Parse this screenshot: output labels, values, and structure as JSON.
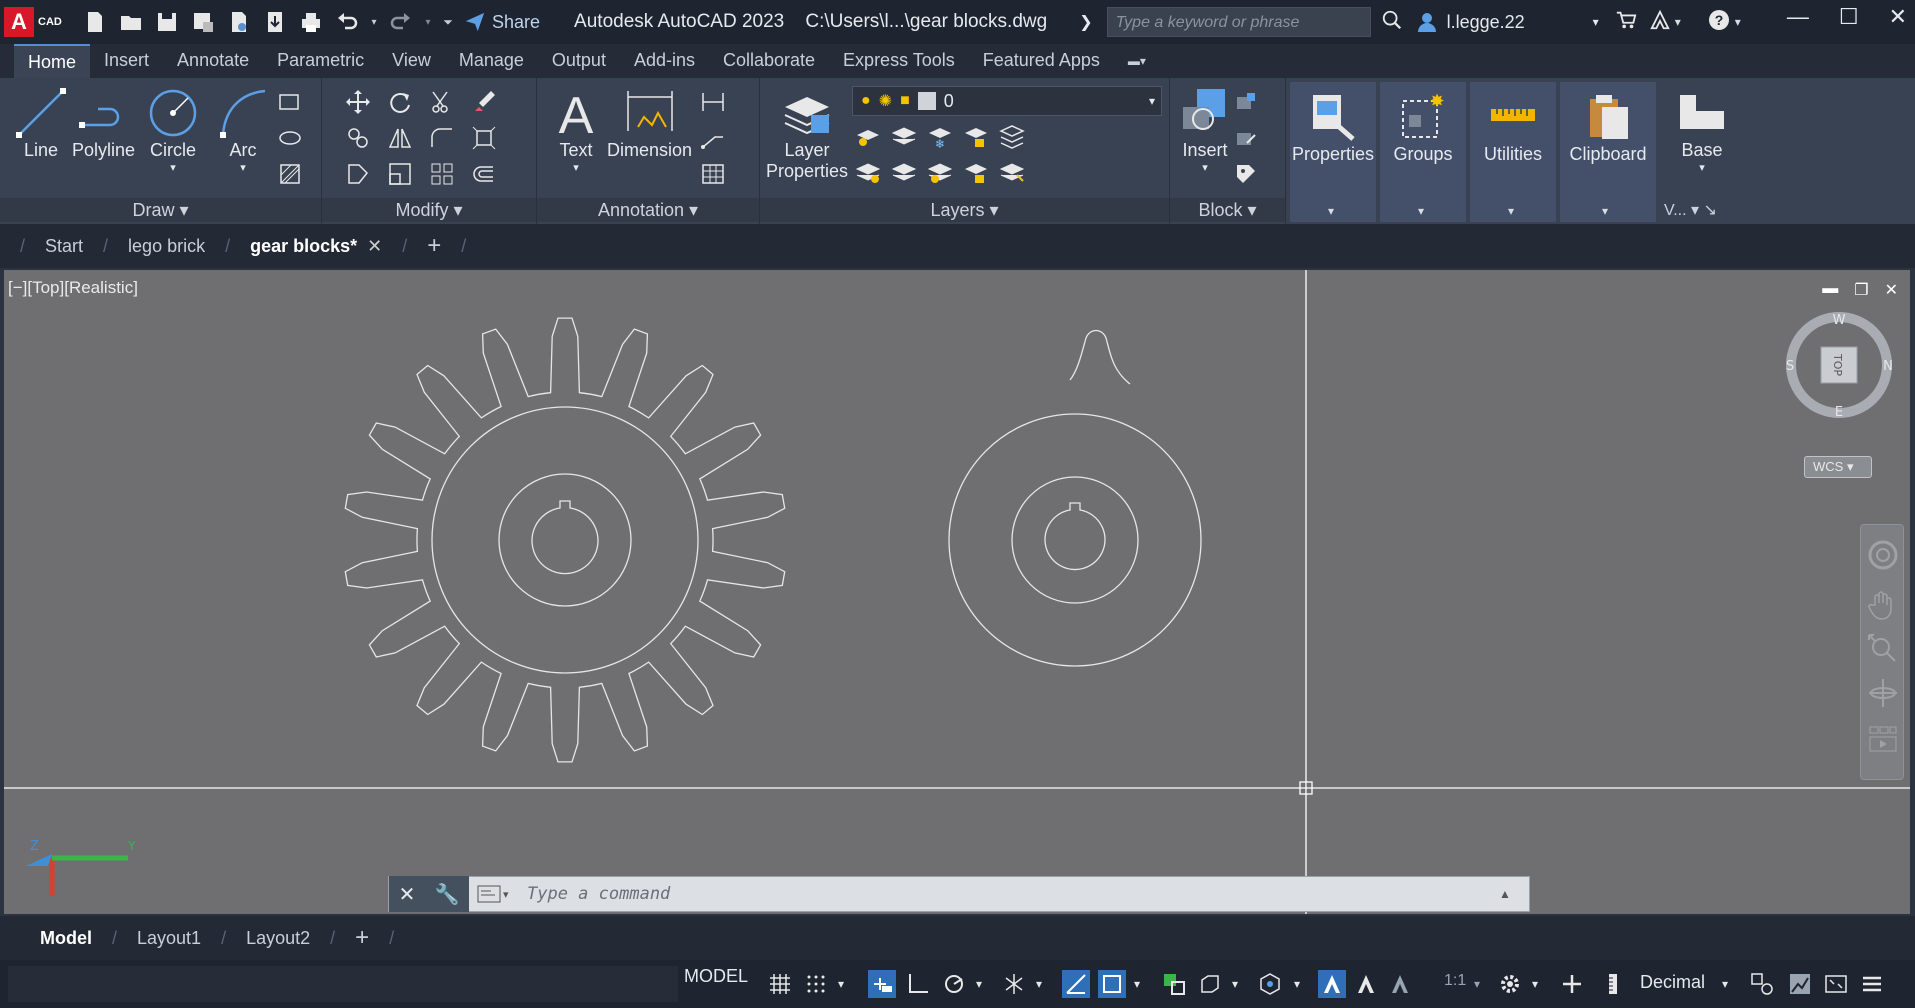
{
  "app": {
    "logo_letter": "A",
    "logo_sub": "CAD",
    "share_label": "Share",
    "title": "Autodesk AutoCAD 2023",
    "file_path": "C:\\Users\\l...\\gear blocks.dwg",
    "search_placeholder": "Type a keyword or phrase",
    "user_name": "l.legge.22"
  },
  "menu_tabs": [
    "Home",
    "Insert",
    "Annotate",
    "Parametric",
    "View",
    "Manage",
    "Output",
    "Add-ins",
    "Collaborate",
    "Express Tools",
    "Featured Apps"
  ],
  "ribbon": {
    "draw": {
      "title": "Draw",
      "line": "Line",
      "polyline": "Polyline",
      "circle": "Circle",
      "arc": "Arc"
    },
    "modify": {
      "title": "Modify"
    },
    "annotation": {
      "title": "Annotation",
      "text": "Text",
      "dimension": "Dimension"
    },
    "layers": {
      "title": "Layers",
      "layer_properties_1": "Layer",
      "layer_properties_2": "Properties",
      "current_layer": "0"
    },
    "block": {
      "title": "Block",
      "insert": "Insert"
    },
    "properties": "Properties",
    "groups": "Groups",
    "utilities": "Utilities",
    "clipboard": "Clipboard",
    "base": "Base",
    "view_short": "V..."
  },
  "file_tabs": [
    "Start",
    "lego brick",
    "gear blocks*"
  ],
  "viewport": {
    "label": "[−][Top][Realistic]",
    "viewcube_top": "TOP",
    "compass_n": "N",
    "compass_s": "S",
    "compass_e": "E",
    "compass_w": "W",
    "wcs": "WCS"
  },
  "command": {
    "placeholder": "Type a command"
  },
  "layout_tabs": [
    "Model",
    "Layout1",
    "Layout2"
  ],
  "status": {
    "model": "MODEL",
    "scale": "1:1",
    "units": "Decimal"
  }
}
